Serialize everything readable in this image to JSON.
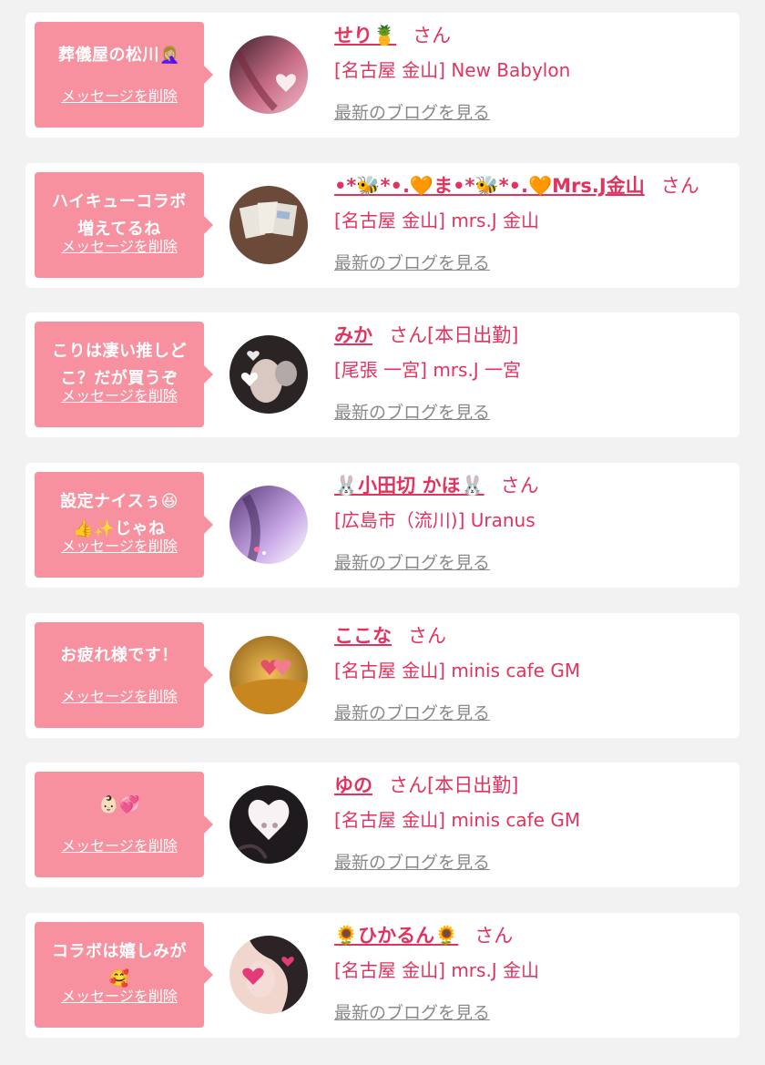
{
  "messages": [
    {
      "message": "葬儀屋の松川🤦🏼‍♀️",
      "delete_label": "メッセージを削除",
      "name": "せり🍍",
      "honorific": "さん",
      "shop": "[名古屋 金山] New Babylon",
      "blog_link": "最新のブログを見る",
      "avatar_colors": [
        "#3a1f2a",
        "#c76d85",
        "#f2b6c8"
      ]
    },
    {
      "message": "ハイキューコラボ\n増えてるね",
      "delete_label": "メッセージを削除",
      "name": "•*🐝*•.🧡ま•*🐝*•.🧡Mrs.J金山",
      "honorific": "さん",
      "shop": "[名古屋 金山] mrs.J 金山",
      "blog_link": "最新のブログを見る",
      "avatar_colors": [
        "#6b4a3a",
        "#e9e4dc",
        "#9fb6d6"
      ]
    },
    {
      "message": "こりは凄い推しど\nこ？だが買うぞ",
      "delete_label": "メッセージを削除",
      "name": "みか",
      "honorific": "さん[本日出勤]",
      "shop": "[尾張 一宮] mrs.J 一宮",
      "blog_link": "最新のブログを見る",
      "avatar_colors": [
        "#2a2424",
        "#d9c8c2",
        "#ffffff"
      ]
    },
    {
      "message": "設定ナイスぅ😆\n👍✨じゃね",
      "delete_label": "メッセージを削除",
      "name": "🐰小田切 かほ🐰",
      "honorific": "さん",
      "shop": "[広島市（流川)] Uranus",
      "blog_link": "最新のブログを見る",
      "avatar_colors": [
        "#5b3b7a",
        "#c8a6e6",
        "#ffffff"
      ]
    },
    {
      "message": "お疲れ様です！",
      "delete_label": "メッセージを削除",
      "name": "ここな",
      "honorific": "さん",
      "shop": "[名古屋 金山] minis cafe GM",
      "blog_link": "最新のブログを見る",
      "avatar_colors": [
        "#c8871e",
        "#f2c15a",
        "#e54f6b"
      ]
    },
    {
      "message": "👶🏻💞",
      "delete_label": "メッセージを削除",
      "name": "ゆの",
      "honorific": "さん[本日出勤]",
      "shop": "[名古屋 金山] minis cafe GM",
      "blog_link": "最新のブログを見る",
      "avatar_colors": [
        "#1f1a1d",
        "#f7f2f4",
        "#b69aa3"
      ]
    },
    {
      "message": "コラボは嬉しみが\n🥰",
      "delete_label": "メッセージを削除",
      "name": "🌻ひかるん🌻",
      "honorific": "さん",
      "shop": "[名古屋 金山] mrs.J 金山",
      "blog_link": "最新のブログを見る",
      "avatar_colors": [
        "#2b2326",
        "#f1d6ce",
        "#e33b78"
      ]
    }
  ]
}
